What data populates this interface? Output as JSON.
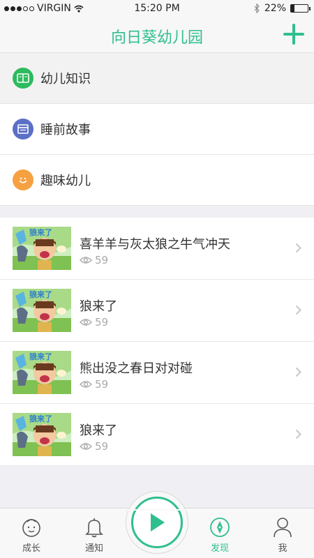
{
  "status": {
    "carrier": "VIRGIN",
    "time": "15:20 PM",
    "battery": "22%",
    "battery_level": 0.22
  },
  "header": {
    "title": "向日葵幼儿园"
  },
  "categories": [
    {
      "label": "幼儿知识",
      "icon": "book-icon",
      "color": "#2cbb5e"
    },
    {
      "label": "睡前故事",
      "icon": "window-icon",
      "color": "#5b6fc7"
    },
    {
      "label": "趣味幼儿",
      "icon": "smile-icon",
      "color": "#f5a142"
    }
  ],
  "stories": [
    {
      "title": "喜羊羊与灰太狼之牛气冲天",
      "views": "59",
      "thumb_text": "狼来了"
    },
    {
      "title": "狼来了",
      "views": "59",
      "thumb_text": "狼来了"
    },
    {
      "title": "熊出没之春日对对碰",
      "views": "59",
      "thumb_text": "狼来了"
    },
    {
      "title": "狼来了",
      "views": "59",
      "thumb_text": "狼来了"
    }
  ],
  "tabs": [
    {
      "label": "成长",
      "icon": "baby-face-icon"
    },
    {
      "label": "通知",
      "icon": "bell-icon"
    },
    {
      "label": "发现",
      "icon": "compass-icon",
      "active": true
    },
    {
      "label": "我",
      "icon": "person-icon"
    }
  ],
  "colors": {
    "accent": "#2fbf8e"
  }
}
